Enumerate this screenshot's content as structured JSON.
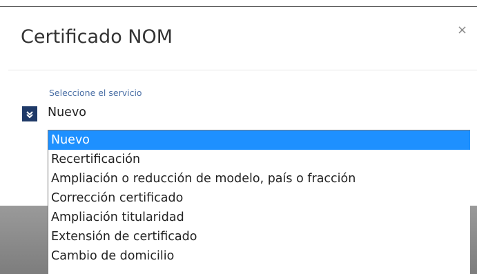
{
  "modal": {
    "title": "Certificado NOM",
    "close_glyph": "×"
  },
  "service_select": {
    "label": "Seleccione el servicio",
    "selected": "Nuevo",
    "toggle_icon": "chevron-down-double-icon",
    "toggle_glyph": "»",
    "options": [
      "Nuevo",
      "Recertificación",
      "Ampliación o reducción de modelo, país o fracción",
      "Corrección certificado",
      "Ampliación titularidad",
      "Extensión de certificado",
      "Cambio de domicilio"
    ],
    "highlight_index": 0
  },
  "colors": {
    "accent": "#1f3a68",
    "highlight": "#1e90ff",
    "label": "#4a6fa5"
  }
}
